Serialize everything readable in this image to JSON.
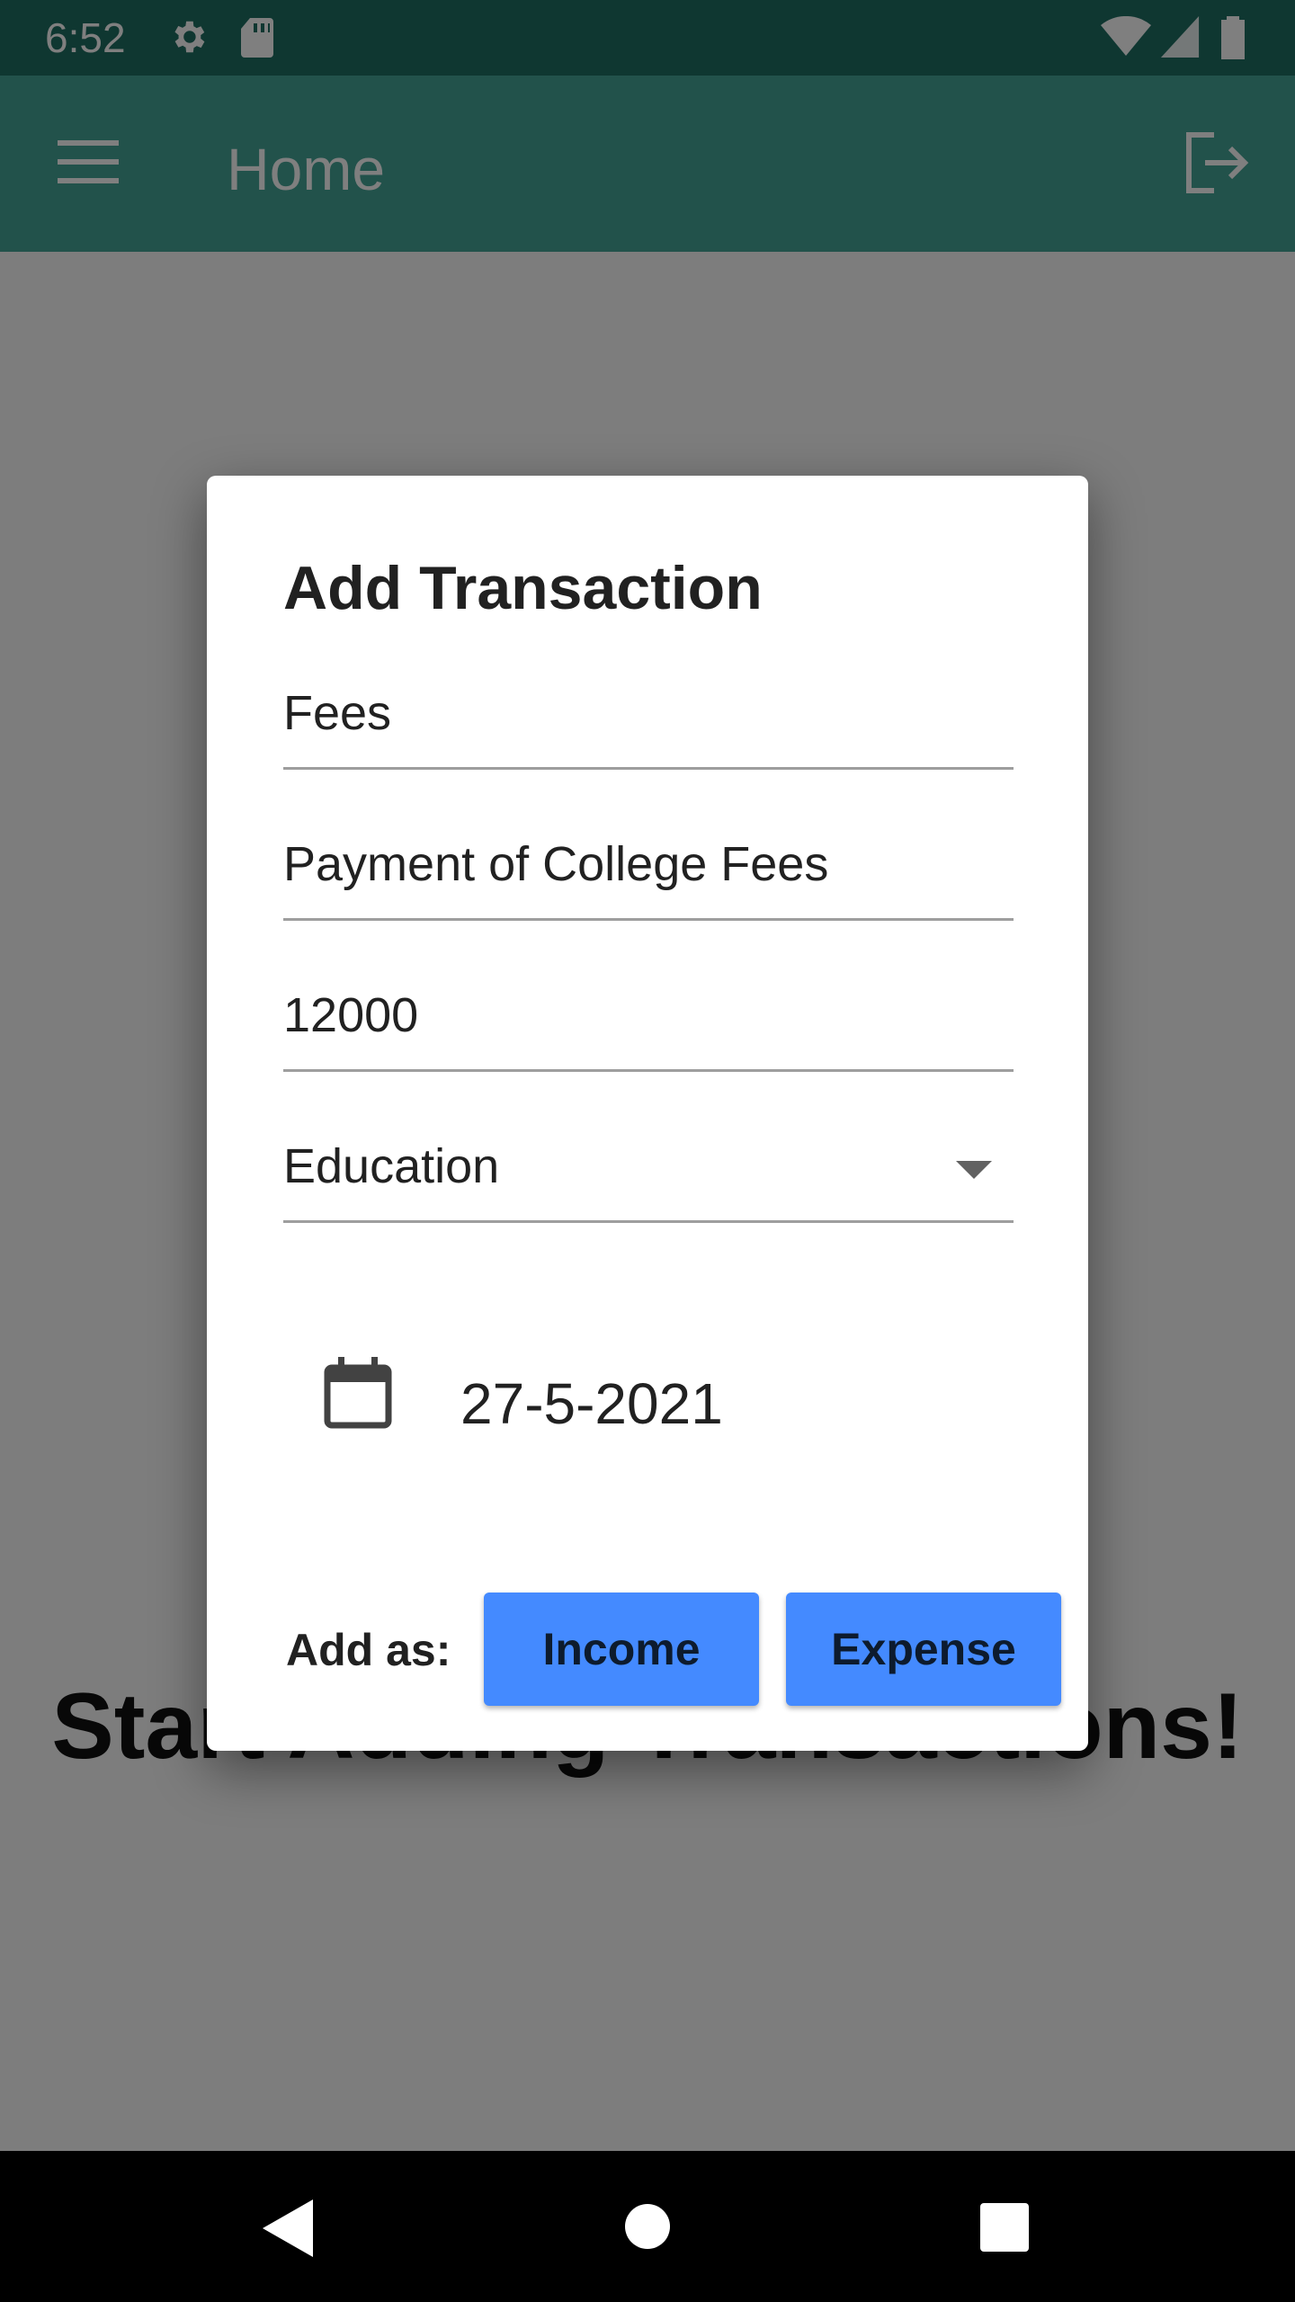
{
  "status_bar": {
    "time": "6:52",
    "icons": [
      "gear-icon",
      "sd-card-icon",
      "wifi-icon",
      "signal-icon",
      "battery-icon"
    ]
  },
  "app_bar": {
    "title": "Home",
    "menu_icon": "menu-icon",
    "exit_icon": "logout-icon",
    "color": "#45a497"
  },
  "page": {
    "empty_text": "Start Adding Transactions!"
  },
  "dialog": {
    "title": "Add Transaction",
    "fields": {
      "name": "Fees",
      "description": "Payment of College Fees",
      "amount": "12000",
      "category": "Education"
    },
    "date": "27-5-2021",
    "add_as_label": "Add as:",
    "income_label": "Income",
    "expense_label": "Expense",
    "button_color": "#448aff"
  },
  "nav_bar": {
    "icons": [
      "back-icon",
      "home-icon",
      "recents-icon"
    ]
  }
}
